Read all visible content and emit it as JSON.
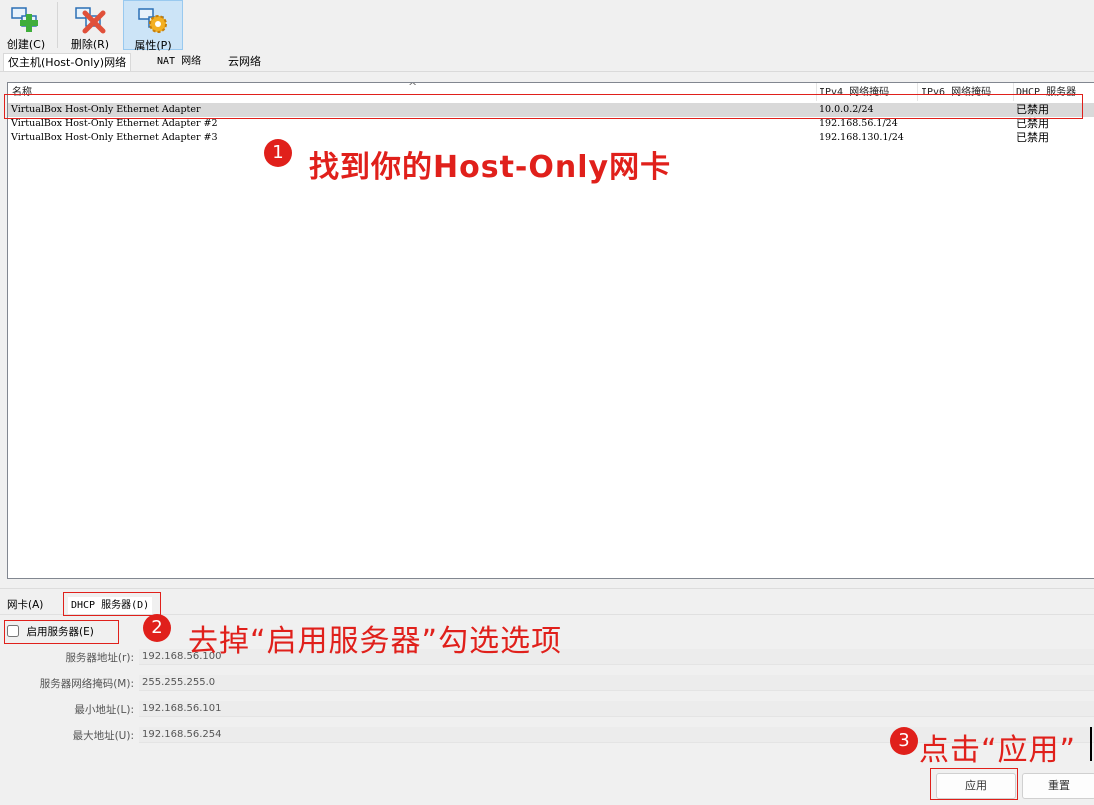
{
  "toolbar": {
    "create_label": "创建(C)",
    "delete_label": "删除(R)",
    "properties_label": "属性(P)"
  },
  "tabs": [
    "仅主机(Host-Only)网络",
    "NAT 网络",
    "云网络"
  ],
  "table": {
    "sort_arrow": "^",
    "columns": [
      "名称",
      "IPv4 网络掩码",
      "IPv6 网络掩码",
      "DHCP 服务器"
    ],
    "rows": [
      {
        "name": "VirtualBox Host-Only Ethernet Adapter",
        "ipv4": "10.0.0.2/24",
        "ipv6": "",
        "dhcp": "已禁用"
      },
      {
        "name": "VirtualBox Host-Only Ethernet Adapter #2",
        "ipv4": "192.168.56.1/24",
        "ipv6": "",
        "dhcp": "已禁用"
      },
      {
        "name": "VirtualBox Host-Only Ethernet Adapter #3",
        "ipv4": "192.168.130.1/24",
        "ipv6": "",
        "dhcp": "已禁用"
      }
    ]
  },
  "bottom_tabs": [
    "网卡(A)",
    "DHCP 服务器(D)"
  ],
  "dhcp": {
    "enable_label": "启用服务器(E)",
    "enabled": false,
    "fields": [
      {
        "label": "服务器地址(r):",
        "value": "192.168.56.100"
      },
      {
        "label": "服务器网络掩码(M):",
        "value": "255.255.255.0"
      },
      {
        "label": "最小地址(L):",
        "value": "192.168.56.101"
      },
      {
        "label": "最大地址(U):",
        "value": "192.168.56.254"
      }
    ]
  },
  "buttons": {
    "apply": "应用",
    "reset": "重置"
  },
  "annotations": [
    {
      "number": "1",
      "text": "找到你的Host-Only网卡"
    },
    {
      "number": "2",
      "text": "去掉“启用服务器”勾选选项"
    },
    {
      "number": "3",
      "text": "点击“应用”"
    }
  ],
  "colors": {
    "annotation": "#e0201b",
    "selected_row": "#d9d9d9",
    "toolbar_active": "#cce4f7"
  },
  "icons": [
    "create-network-icon",
    "delete-network-icon",
    "properties-gear-icon"
  ]
}
